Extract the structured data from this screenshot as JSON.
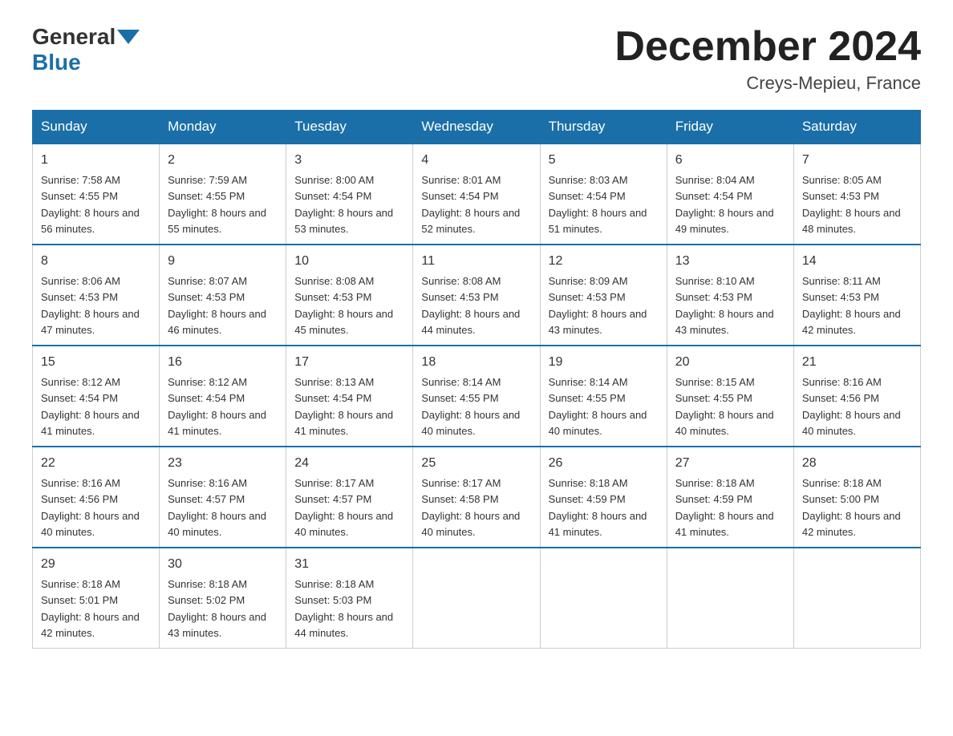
{
  "header": {
    "logo_general": "General",
    "logo_blue": "Blue",
    "month_title": "December 2024",
    "location": "Creys-Mepieu, France"
  },
  "days_of_week": [
    "Sunday",
    "Monday",
    "Tuesday",
    "Wednesday",
    "Thursday",
    "Friday",
    "Saturday"
  ],
  "weeks": [
    [
      {
        "day": "1",
        "sunrise": "7:58 AM",
        "sunset": "4:55 PM",
        "daylight": "8 hours and 56 minutes."
      },
      {
        "day": "2",
        "sunrise": "7:59 AM",
        "sunset": "4:55 PM",
        "daylight": "8 hours and 55 minutes."
      },
      {
        "day": "3",
        "sunrise": "8:00 AM",
        "sunset": "4:54 PM",
        "daylight": "8 hours and 53 minutes."
      },
      {
        "day": "4",
        "sunrise": "8:01 AM",
        "sunset": "4:54 PM",
        "daylight": "8 hours and 52 minutes."
      },
      {
        "day": "5",
        "sunrise": "8:03 AM",
        "sunset": "4:54 PM",
        "daylight": "8 hours and 51 minutes."
      },
      {
        "day": "6",
        "sunrise": "8:04 AM",
        "sunset": "4:54 PM",
        "daylight": "8 hours and 49 minutes."
      },
      {
        "day": "7",
        "sunrise": "8:05 AM",
        "sunset": "4:53 PM",
        "daylight": "8 hours and 48 minutes."
      }
    ],
    [
      {
        "day": "8",
        "sunrise": "8:06 AM",
        "sunset": "4:53 PM",
        "daylight": "8 hours and 47 minutes."
      },
      {
        "day": "9",
        "sunrise": "8:07 AM",
        "sunset": "4:53 PM",
        "daylight": "8 hours and 46 minutes."
      },
      {
        "day": "10",
        "sunrise": "8:08 AM",
        "sunset": "4:53 PM",
        "daylight": "8 hours and 45 minutes."
      },
      {
        "day": "11",
        "sunrise": "8:08 AM",
        "sunset": "4:53 PM",
        "daylight": "8 hours and 44 minutes."
      },
      {
        "day": "12",
        "sunrise": "8:09 AM",
        "sunset": "4:53 PM",
        "daylight": "8 hours and 43 minutes."
      },
      {
        "day": "13",
        "sunrise": "8:10 AM",
        "sunset": "4:53 PM",
        "daylight": "8 hours and 43 minutes."
      },
      {
        "day": "14",
        "sunrise": "8:11 AM",
        "sunset": "4:53 PM",
        "daylight": "8 hours and 42 minutes."
      }
    ],
    [
      {
        "day": "15",
        "sunrise": "8:12 AM",
        "sunset": "4:54 PM",
        "daylight": "8 hours and 41 minutes."
      },
      {
        "day": "16",
        "sunrise": "8:12 AM",
        "sunset": "4:54 PM",
        "daylight": "8 hours and 41 minutes."
      },
      {
        "day": "17",
        "sunrise": "8:13 AM",
        "sunset": "4:54 PM",
        "daylight": "8 hours and 41 minutes."
      },
      {
        "day": "18",
        "sunrise": "8:14 AM",
        "sunset": "4:55 PM",
        "daylight": "8 hours and 40 minutes."
      },
      {
        "day": "19",
        "sunrise": "8:14 AM",
        "sunset": "4:55 PM",
        "daylight": "8 hours and 40 minutes."
      },
      {
        "day": "20",
        "sunrise": "8:15 AM",
        "sunset": "4:55 PM",
        "daylight": "8 hours and 40 minutes."
      },
      {
        "day": "21",
        "sunrise": "8:16 AM",
        "sunset": "4:56 PM",
        "daylight": "8 hours and 40 minutes."
      }
    ],
    [
      {
        "day": "22",
        "sunrise": "8:16 AM",
        "sunset": "4:56 PM",
        "daylight": "8 hours and 40 minutes."
      },
      {
        "day": "23",
        "sunrise": "8:16 AM",
        "sunset": "4:57 PM",
        "daylight": "8 hours and 40 minutes."
      },
      {
        "day": "24",
        "sunrise": "8:17 AM",
        "sunset": "4:57 PM",
        "daylight": "8 hours and 40 minutes."
      },
      {
        "day": "25",
        "sunrise": "8:17 AM",
        "sunset": "4:58 PM",
        "daylight": "8 hours and 40 minutes."
      },
      {
        "day": "26",
        "sunrise": "8:18 AM",
        "sunset": "4:59 PM",
        "daylight": "8 hours and 41 minutes."
      },
      {
        "day": "27",
        "sunrise": "8:18 AM",
        "sunset": "4:59 PM",
        "daylight": "8 hours and 41 minutes."
      },
      {
        "day": "28",
        "sunrise": "8:18 AM",
        "sunset": "5:00 PM",
        "daylight": "8 hours and 42 minutes."
      }
    ],
    [
      {
        "day": "29",
        "sunrise": "8:18 AM",
        "sunset": "5:01 PM",
        "daylight": "8 hours and 42 minutes."
      },
      {
        "day": "30",
        "sunrise": "8:18 AM",
        "sunset": "5:02 PM",
        "daylight": "8 hours and 43 minutes."
      },
      {
        "day": "31",
        "sunrise": "8:18 AM",
        "sunset": "5:03 PM",
        "daylight": "8 hours and 44 minutes."
      },
      null,
      null,
      null,
      null
    ]
  ],
  "labels": {
    "sunrise_prefix": "Sunrise: ",
    "sunset_prefix": "Sunset: ",
    "daylight_prefix": "Daylight: "
  }
}
